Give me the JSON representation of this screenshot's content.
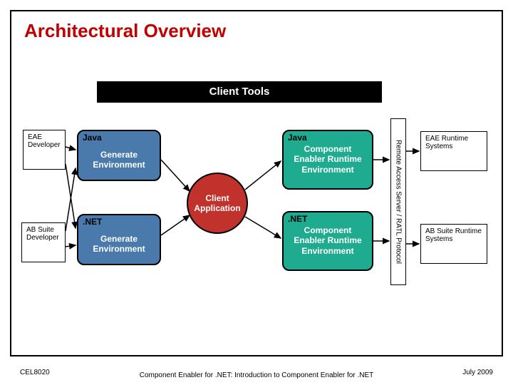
{
  "title": "Architectural Overview",
  "banner": "Client Tools",
  "left_inputs": {
    "eae": "EAE Developer",
    "ab": "AB Suite Developer"
  },
  "gen_java": {
    "label": "Java",
    "text": "Generate Environment"
  },
  "gen_net": {
    "label": ".NET",
    "text": "Generate Environment"
  },
  "client": "Client Application",
  "rt_java": {
    "label": "Java",
    "text": "Component Enabler Runtime Environment"
  },
  "rt_net": {
    "label": ".NET",
    "text": "Component Enabler Runtime Environment"
  },
  "ratl": "Remote Access Server / RATL Protocol",
  "right_out": {
    "eae": "EAE Runtime Systems",
    "ab": "AB Suite Runtime Systems"
  },
  "footer": {
    "code": "CEL8020",
    "subtitle": "Component Enabler for .NET: Introduction to Component Enabler for .NET",
    "date": "July 2009"
  }
}
